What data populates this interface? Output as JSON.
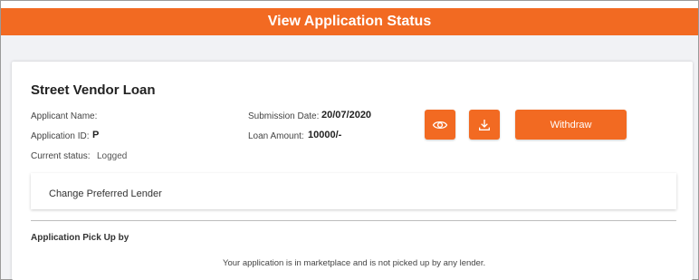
{
  "header": {
    "title": "View Application Status"
  },
  "application": {
    "loan_name": "Street Vendor Loan",
    "applicant_name_label": "Applicant Name:",
    "applicant_name_value": "",
    "application_id_label": "Application ID:",
    "application_id_value": "P",
    "current_status_label": "Current status:",
    "current_status_value": "Logged",
    "submission_date_label": "Submission Date:",
    "submission_date_value": "20/07/2020",
    "loan_amount_label": "Loan Amount:",
    "loan_amount_value": "10000/-"
  },
  "actions": {
    "view_icon": "eye-icon",
    "download_icon": "download-icon",
    "withdraw_label": "Withdraw"
  },
  "lender": {
    "change_label": "Change Preferred Lender"
  },
  "pickup": {
    "title": "Application Pick Up by",
    "message": "Your application is in marketplace and is not picked up by any lender."
  },
  "colors": {
    "accent": "#f26a22",
    "background": "#f1f2f5"
  }
}
